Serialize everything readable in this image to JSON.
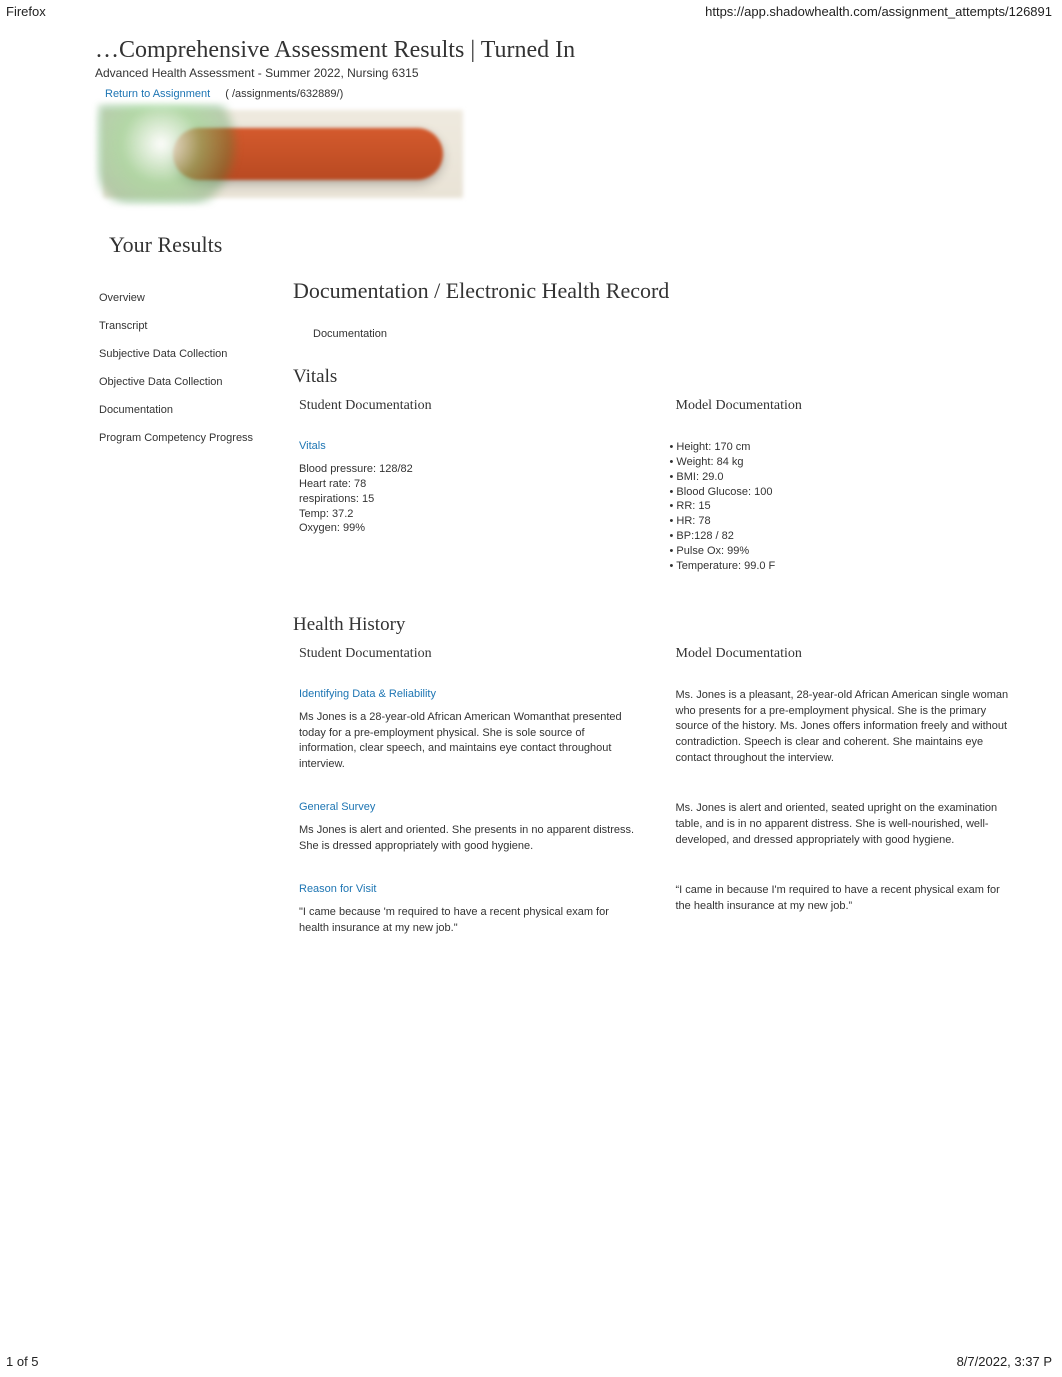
{
  "browser_name": "Firefox",
  "page_url": "https://app.shadowhealth.com/assignment_attempts/126891",
  "title": "…Comprehensive Assessment Results | Turned In",
  "subtitle": "Advanced Health Assessment - Summer 2022, Nursing 6315",
  "return_link": {
    "label": "Return to Assignment",
    "path": "( /assignments/632889/)"
  },
  "results_heading": "Your Results",
  "sidebar": {
    "items": [
      "Overview",
      "Transcript",
      "Subjective Data Collection",
      "Objective Data Collection",
      "Documentation",
      "Program Competency Progress"
    ]
  },
  "content": {
    "section_title": "Documentation / Electronic Health Record",
    "doc_chip": "Documentation",
    "col_student": "Student Documentation",
    "col_model": "Model Documentation",
    "vitals": {
      "heading": "Vitals",
      "student": {
        "label": "Vitals",
        "lines": [
          "Blood pressure: 128/82",
          "Heart rate: 78",
          "respirations: 15",
          "Temp: 37.2",
          "Oxygen: 99%"
        ]
      },
      "model_bullets": [
        "Height: 170 cm",
        "Weight: 84 kg",
        "BMI: 29.0",
        "Blood Glucose: 100",
        "RR: 15",
        "HR: 78",
        "BP:128 / 82",
        "Pulse Ox: 99%",
        "Temperature: 99.0 F"
      ]
    },
    "health_history": {
      "heading": "Health History",
      "blocks": [
        {
          "label": "Identifying Data & Reliability",
          "student": "Ms Jones is a 28-year-old African American Womanthat presented today for a pre-employment physical. She is sole source of information, clear speech, and maintains eye contact throughout interview.",
          "model": "Ms. Jones is a pleasant, 28-year-old African American single woman who presents for a pre-employment physical. She is the primary source of the history. Ms. Jones offers information freely and without contradiction. Speech is clear and coherent. She maintains eye contact throughout the interview."
        },
        {
          "label": "General Survey",
          "student": "Ms Jones is alert and oriented. She presents in no apparent distress. She is dressed appropriately with good hygiene.",
          "model": "Ms. Jones is alert and oriented, seated upright on the examination table, and is in no apparent distress. She is well-nourished, well-developed, and dressed appropriately with good hygiene."
        },
        {
          "label": "Reason for Visit",
          "student": "\"I came because 'm required to have a recent physical exam for health insurance at my new job.\"",
          "model": "“I came in because I'm required to have a recent physical exam for the health insurance at my new job.”"
        }
      ]
    }
  },
  "footer": {
    "page": "1 of 5",
    "timestamp": "8/7/2022, 3:37 P"
  }
}
